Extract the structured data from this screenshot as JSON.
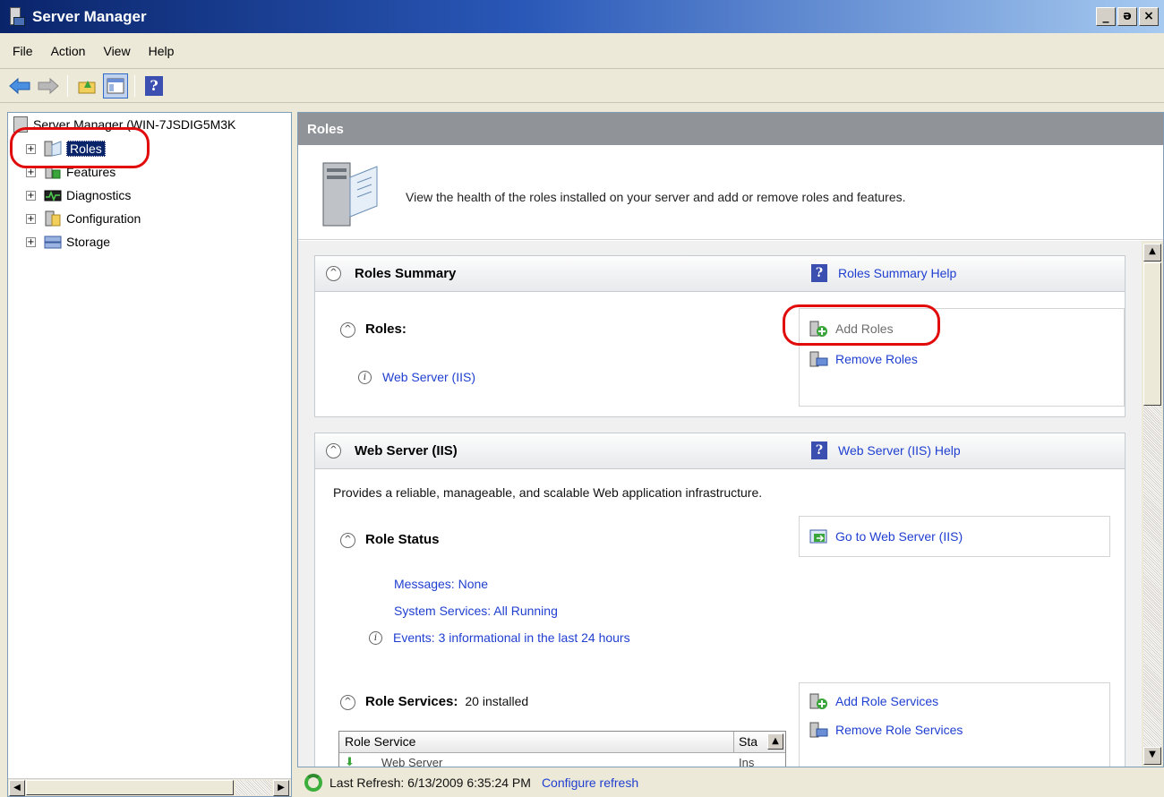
{
  "window": {
    "title": "Server Manager",
    "controls": [
      "_",
      "ǝ",
      "×"
    ]
  },
  "menu": [
    "File",
    "Action",
    "View",
    "Help"
  ],
  "toolbar": {
    "help": "?"
  },
  "tree": {
    "root": "Server Manager (WIN-7JSDIG5M3K",
    "items": [
      {
        "label": "Roles",
        "icon": "roles-icon",
        "selected": true
      },
      {
        "label": "Features",
        "icon": "features-icon"
      },
      {
        "label": "Diagnostics",
        "icon": "diagnostics-icon"
      },
      {
        "label": "Configuration",
        "icon": "configuration-icon"
      },
      {
        "label": "Storage",
        "icon": "storage-icon"
      }
    ]
  },
  "main": {
    "header": "Roles",
    "banner": "View the health of the roles installed on your server and add or remove roles and features.",
    "summary": {
      "title": "Roles Summary",
      "help": "Roles Summary Help",
      "roles_label": "Roles:",
      "role_link": "Web Server (IIS)",
      "add_roles": "Add Roles",
      "remove_roles": "Remove Roles"
    },
    "webserver": {
      "title": "Web Server (IIS)",
      "help": "Web Server (IIS) Help",
      "description": "Provides a reliable, manageable, and scalable Web application infrastructure.",
      "role_status": "Role Status",
      "goto": "Go to Web Server (IIS)",
      "messages": "Messages: None",
      "services": "System Services: All Running",
      "events": "Events: 3 informational in the last 24 hours",
      "role_services": "Role Services:",
      "installed": "20 installed",
      "add_services": "Add Role Services",
      "remove_services": "Remove Role Services",
      "grid_col1": "Role Service",
      "grid_col2": "Sta",
      "grid_row1": "Web Server",
      "grid_row1_status": "Ins"
    }
  },
  "status": {
    "last_refresh": "Last Refresh: 6/13/2009 6:35:24 PM",
    "configure": "Configure refresh"
  },
  "colors": {
    "highlight_oval": "#e10b0b",
    "link": "#1f3fd0",
    "selection": "#0a246a"
  }
}
